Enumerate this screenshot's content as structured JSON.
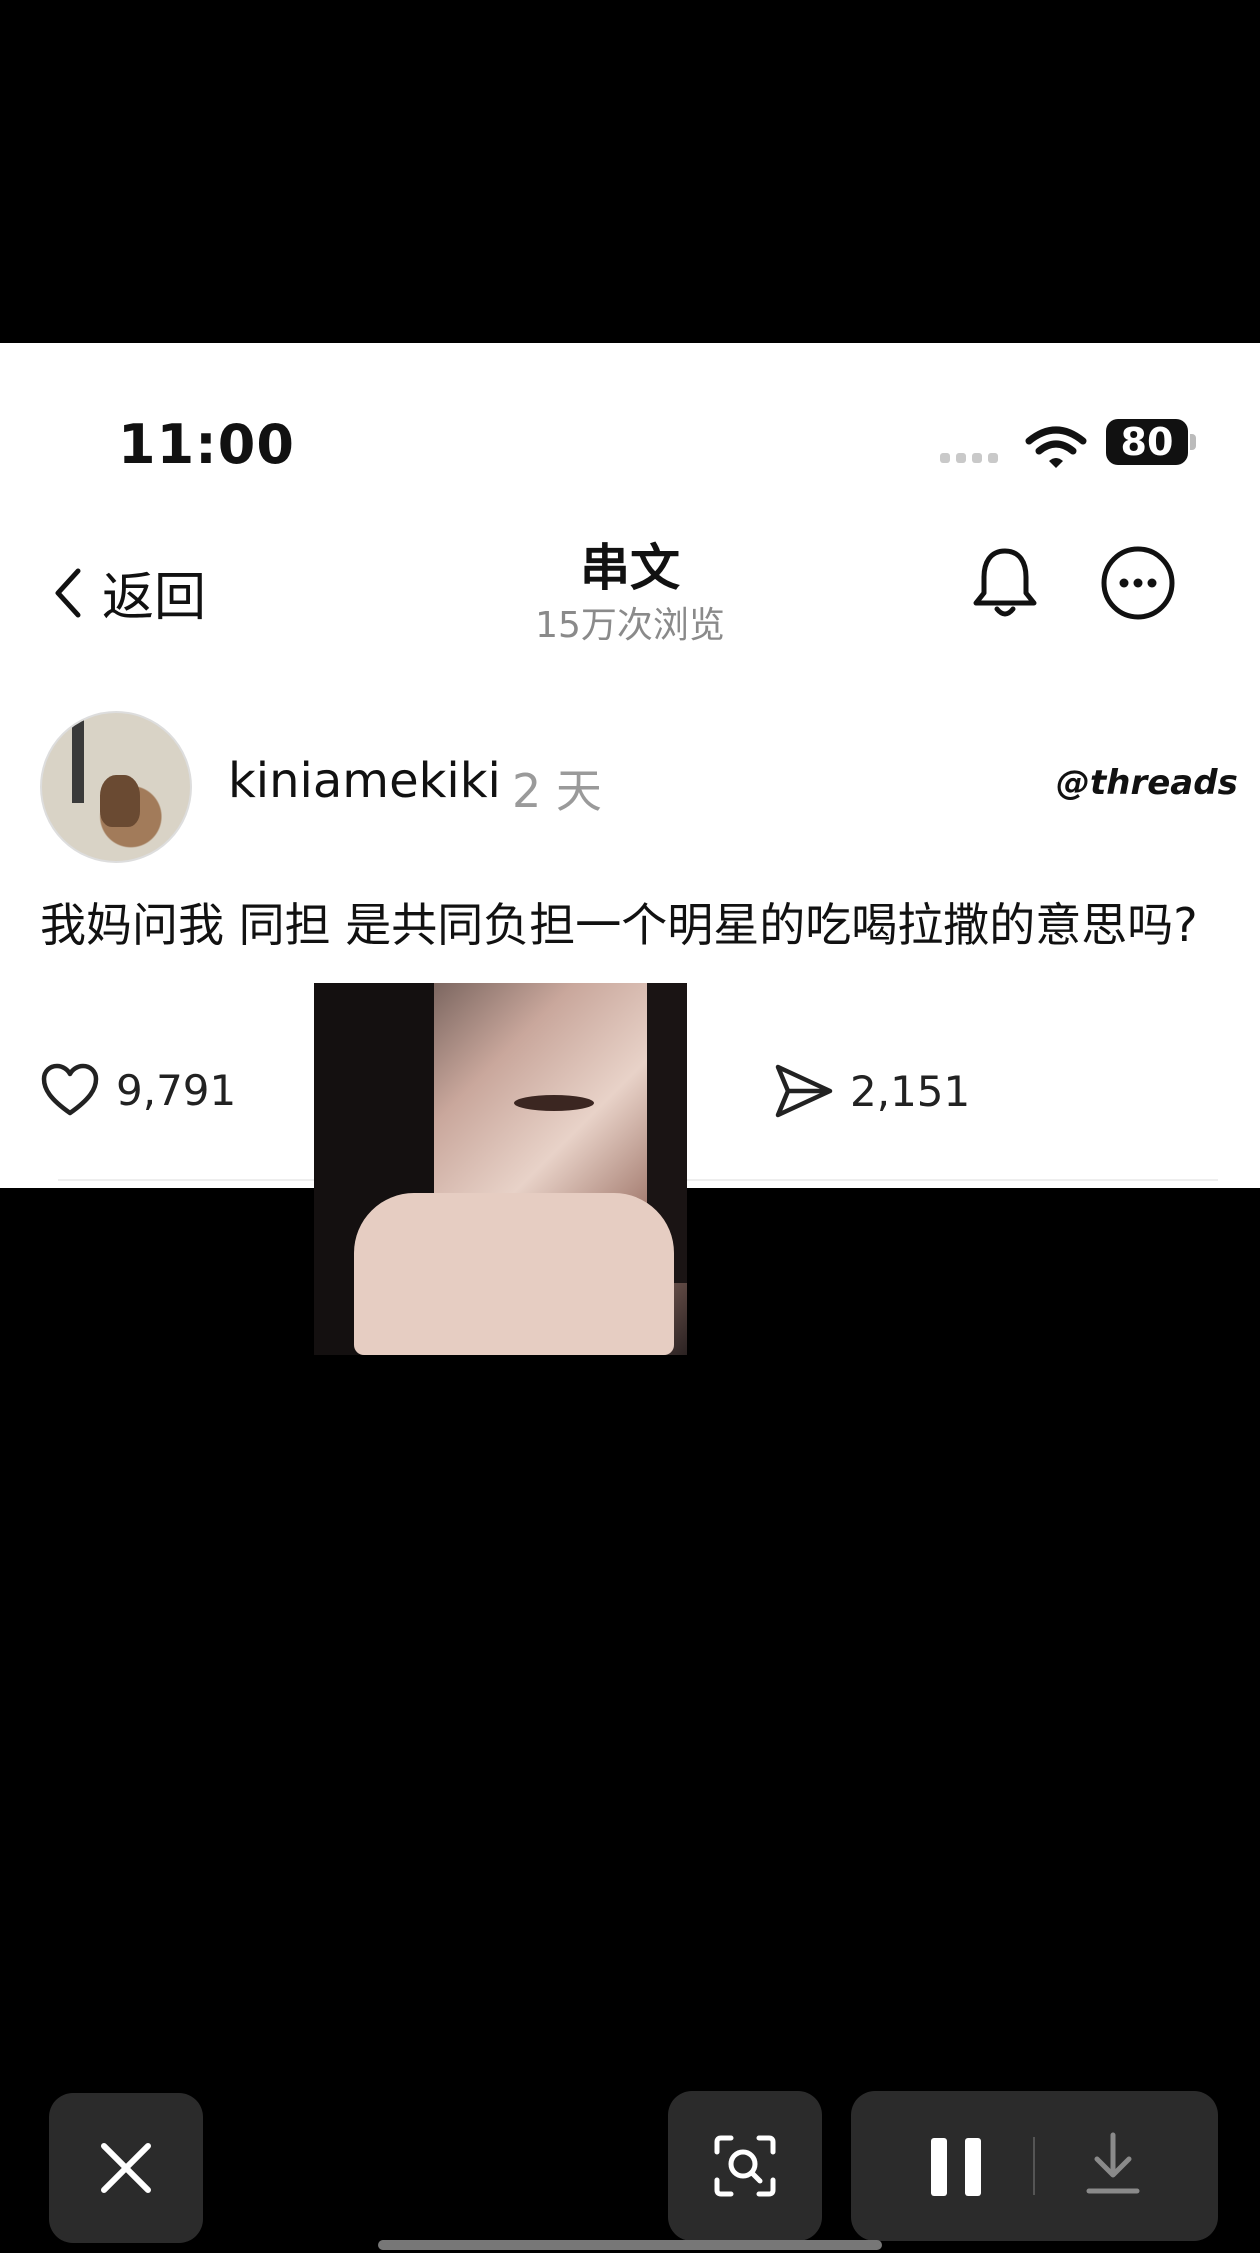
{
  "status_bar": {
    "time": "11:00",
    "battery": "80"
  },
  "nav": {
    "back_label": "返回",
    "title": "串文",
    "views": "15万次浏览"
  },
  "post": {
    "username": "kiniamekiki",
    "age": "2 天",
    "brand": "threads",
    "text": "我妈问我 同担 是共同负担一个明星的吃喝拉撒的意思吗?",
    "likes": "9,791",
    "shares": "2,151"
  },
  "icons": {
    "back": "chevron-left-icon",
    "bell": "bell-icon",
    "more": "more-icon",
    "like": "heart-icon",
    "share": "share-icon",
    "close": "close-icon",
    "lens": "visual-search-icon",
    "pause": "pause-icon",
    "download": "download-icon"
  }
}
